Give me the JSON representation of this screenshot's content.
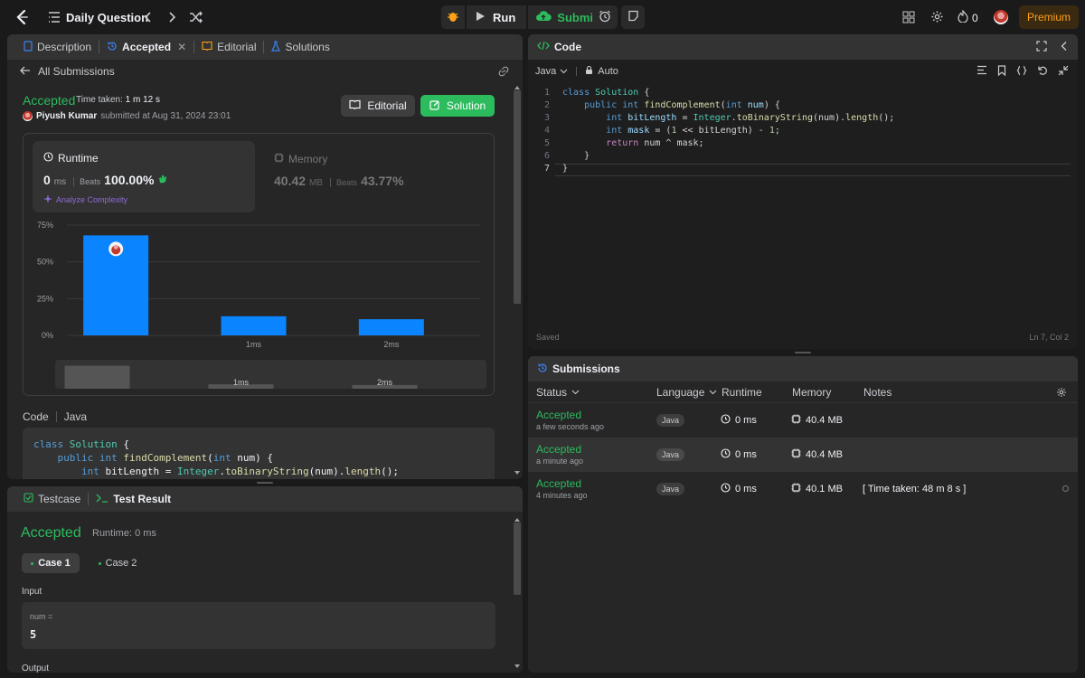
{
  "topbar": {
    "title": "Daily Question",
    "run_label": "Run",
    "submit_label": "Submit",
    "streak_count": "0",
    "premium_label": "Premium"
  },
  "left_panel": {
    "tabs": [
      {
        "label": "Description"
      },
      {
        "label": "Accepted"
      },
      {
        "label": "Editorial"
      },
      {
        "label": "Solutions"
      }
    ],
    "all_submissions": "All Submissions",
    "status": "Accepted",
    "time_taken_label": "Time taken:",
    "time_taken_value": "1 m 12 s",
    "user_name": "Piyush Kumar",
    "submitted_text": "submitted at Aug 31, 2024 23:01",
    "editorial_btn": "Editorial",
    "solution_btn": "Solution",
    "runtime": {
      "label": "Runtime",
      "value": "0",
      "unit": "ms",
      "beats_label": "Beats",
      "beats_value": "100.00%",
      "analyze": "Analyze Complexity"
    },
    "memory": {
      "label": "Memory",
      "value": "40.42",
      "unit": "MB",
      "beats_label": "Beats",
      "beats_value": "43.77%"
    },
    "code_label": "Code",
    "code_lang": "Java",
    "code_preview": [
      "class Solution {",
      "    public int findComplement(int num) {",
      "        int bitLength = Integer.toBinaryString(num).length();"
    ]
  },
  "chart_data": {
    "type": "bar",
    "categories": [
      "",
      "1ms",
      "2ms"
    ],
    "values": [
      68,
      13,
      11
    ],
    "yticks": [
      "0%",
      "25%",
      "50%",
      "75%"
    ],
    "ylim": [
      0,
      75
    ],
    "highlight_index": 0,
    "bar_color": "#0a84ff",
    "grid": true
  },
  "minimap": {
    "labels": [
      "",
      "1ms",
      "2ms"
    ]
  },
  "test_panel": {
    "tabs": [
      {
        "label": "Testcase"
      },
      {
        "label": "Test Result"
      }
    ],
    "status": "Accepted",
    "runtime": "Runtime: 0 ms",
    "cases": [
      "Case 1",
      "Case 2"
    ],
    "input_label": "Input",
    "input_name": "num =",
    "input_value": "5",
    "output_label": "Output"
  },
  "code_panel": {
    "title": "Code",
    "language": "Java",
    "mode": "Auto",
    "saved": "Saved",
    "cursor": "Ln 7, Col 2",
    "line_numbers": [
      "1",
      "2",
      "3",
      "4",
      "5",
      "6",
      "7"
    ]
  },
  "submissions": {
    "title": "Submissions",
    "columns": [
      "Status",
      "Language",
      "Runtime",
      "Memory",
      "Notes"
    ],
    "rows": [
      {
        "status": "Accepted",
        "time": "a few seconds ago",
        "lang": "Java",
        "runtime": "0 ms",
        "memory": "40.4 MB",
        "note": ""
      },
      {
        "status": "Accepted",
        "time": "a minute ago",
        "lang": "Java",
        "runtime": "0 ms",
        "memory": "40.4 MB",
        "note": ""
      },
      {
        "status": "Accepted",
        "time": "4 minutes ago",
        "lang": "Java",
        "runtime": "0 ms",
        "memory": "40.1 MB",
        "note": "[ Time taken: 48 m 8 s ]"
      }
    ]
  },
  "colors": {
    "accent_green": "#2cbb5d",
    "premium": "#ffa116",
    "bar_blue": "#0a84ff"
  }
}
